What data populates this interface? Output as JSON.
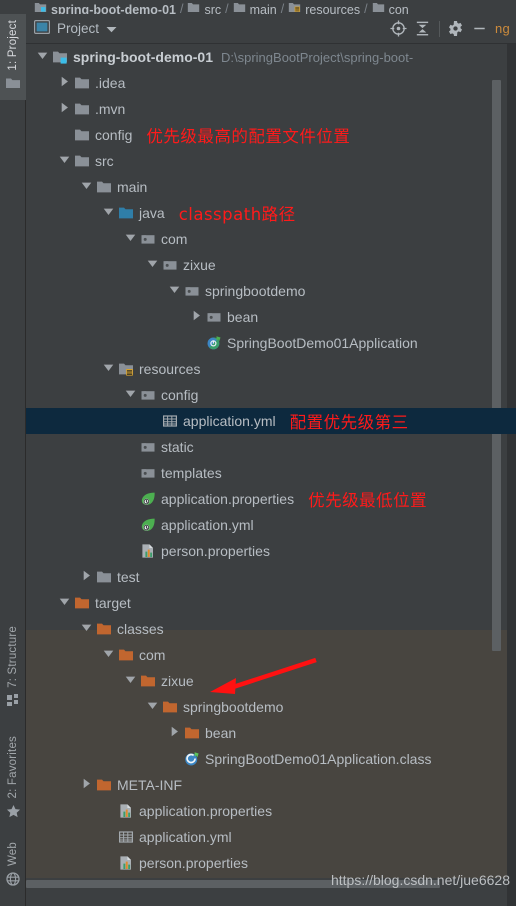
{
  "breadcrumb": {
    "items": [
      {
        "label": "spring-boot-demo-01",
        "icon": "module-icon",
        "bold": true
      },
      {
        "label": "src",
        "icon": "folder-icon",
        "bold": false
      },
      {
        "label": "main",
        "icon": "folder-icon",
        "bold": false
      },
      {
        "label": "resources",
        "icon": "resources-folder-icon",
        "bold": false
      },
      {
        "label": "con",
        "icon": "folder-icon",
        "bold": false
      }
    ],
    "separator": "/"
  },
  "rail": {
    "project": {
      "label": "1: Project",
      "icon": "folder-icon"
    },
    "structure": {
      "label": "7: Structure",
      "icon": "structure-icon"
    },
    "favorites": {
      "label": "2: Favorites",
      "icon": "star-icon"
    },
    "web": {
      "label": "Web",
      "icon": "globe-icon"
    }
  },
  "header": {
    "title": "Project",
    "title_icon": "project-view-icon",
    "dropdown_icon": "chevron-down-icon",
    "locate_icon": "scroll-from-source-icon",
    "collapse_icon": "collapse-all-icon",
    "settings_icon": "gear-icon",
    "hide_icon": "minimize-icon",
    "overflow_text": "ng"
  },
  "colors": {
    "background": "#3c3f41",
    "selection": "#0d293e",
    "excluded_band": "#484540",
    "annotation_red": "#ff1a1a",
    "text": "#b7bdc3",
    "path_text": "#7e878f",
    "source_root_blue": "#3b7fa8",
    "excluded_orange": "#c1662f"
  },
  "tree": {
    "rows": [
      {
        "indent": 0,
        "arrow": "expanded",
        "icon": "module-icon",
        "label": "spring-boot-demo-01",
        "bold": true,
        "path": "D:\\springBootProject\\spring-boot-"
      },
      {
        "indent": 1,
        "arrow": "collapsed",
        "icon": "folder-icon",
        "label": ".idea"
      },
      {
        "indent": 1,
        "arrow": "collapsed",
        "icon": "folder-icon",
        "label": ".mvn"
      },
      {
        "indent": 1,
        "arrow": "none",
        "icon": "folder-icon",
        "label": "config",
        "annotation": "优先级最高的配置文件位置"
      },
      {
        "indent": 1,
        "arrow": "expanded",
        "icon": "folder-icon",
        "label": "src"
      },
      {
        "indent": 2,
        "arrow": "expanded",
        "icon": "folder-icon",
        "label": "main"
      },
      {
        "indent": 3,
        "arrow": "expanded",
        "icon": "source-root-icon",
        "label": "java",
        "annotation": "classpath路径"
      },
      {
        "indent": 4,
        "arrow": "expanded",
        "icon": "package-icon",
        "label": "com"
      },
      {
        "indent": 5,
        "arrow": "expanded",
        "icon": "package-icon",
        "label": "zixue"
      },
      {
        "indent": 6,
        "arrow": "expanded",
        "icon": "package-icon",
        "label": "springbootdemo"
      },
      {
        "indent": 7,
        "arrow": "collapsed",
        "icon": "package-icon",
        "label": "bean"
      },
      {
        "indent": 7,
        "arrow": "none",
        "icon": "spring-class-icon",
        "label": "SpringBootDemo01Application"
      },
      {
        "indent": 3,
        "arrow": "expanded",
        "icon": "resources-folder-icon",
        "label": "resources"
      },
      {
        "indent": 4,
        "arrow": "expanded",
        "icon": "package-icon",
        "label": "config"
      },
      {
        "indent": 5,
        "arrow": "none",
        "icon": "yaml-file-icon",
        "label": "application.yml",
        "selected": true,
        "annotation": "配置优先级第三"
      },
      {
        "indent": 4,
        "arrow": "none",
        "icon": "package-icon",
        "label": "static"
      },
      {
        "indent": 4,
        "arrow": "none",
        "icon": "package-icon",
        "label": "templates"
      },
      {
        "indent": 4,
        "arrow": "none",
        "icon": "spring-leaf-icon",
        "label": "application.properties",
        "annotation": "优先级最低位置"
      },
      {
        "indent": 4,
        "arrow": "none",
        "icon": "spring-leaf-icon",
        "label": "application.yml"
      },
      {
        "indent": 4,
        "arrow": "none",
        "icon": "properties-file-icon",
        "label": "person.properties"
      },
      {
        "indent": 2,
        "arrow": "collapsed",
        "icon": "folder-icon",
        "label": "test"
      },
      {
        "indent": 1,
        "arrow": "expanded",
        "icon": "excluded-folder-icon",
        "label": "target"
      },
      {
        "indent": 2,
        "arrow": "expanded",
        "icon": "excluded-folder-icon",
        "label": "classes"
      },
      {
        "indent": 3,
        "arrow": "expanded",
        "icon": "excluded-folder-icon",
        "label": "com"
      },
      {
        "indent": 4,
        "arrow": "expanded",
        "icon": "excluded-folder-icon",
        "label": "zixue"
      },
      {
        "indent": 5,
        "arrow": "expanded",
        "icon": "excluded-folder-icon",
        "label": "springbootdemo"
      },
      {
        "indent": 6,
        "arrow": "collapsed",
        "icon": "excluded-folder-icon",
        "label": "bean"
      },
      {
        "indent": 6,
        "arrow": "none",
        "icon": "class-file-icon",
        "label": "SpringBootDemo01Application.class"
      },
      {
        "indent": 2,
        "arrow": "collapsed",
        "icon": "excluded-folder-icon",
        "label": "META-INF"
      },
      {
        "indent": 3,
        "arrow": "none",
        "icon": "properties-file-icon",
        "label": "application.properties"
      },
      {
        "indent": 3,
        "arrow": "none",
        "icon": "yaml-file-icon",
        "label": "application.yml"
      },
      {
        "indent": 3,
        "arrow": "none",
        "icon": "properties-file-icon",
        "label": "person.properties"
      }
    ]
  },
  "annotations": {
    "arrow_to_classes": "red-arrow-pointing-left"
  },
  "watermark": {
    "text": "https://blog.csdn.net/jue6628"
  }
}
